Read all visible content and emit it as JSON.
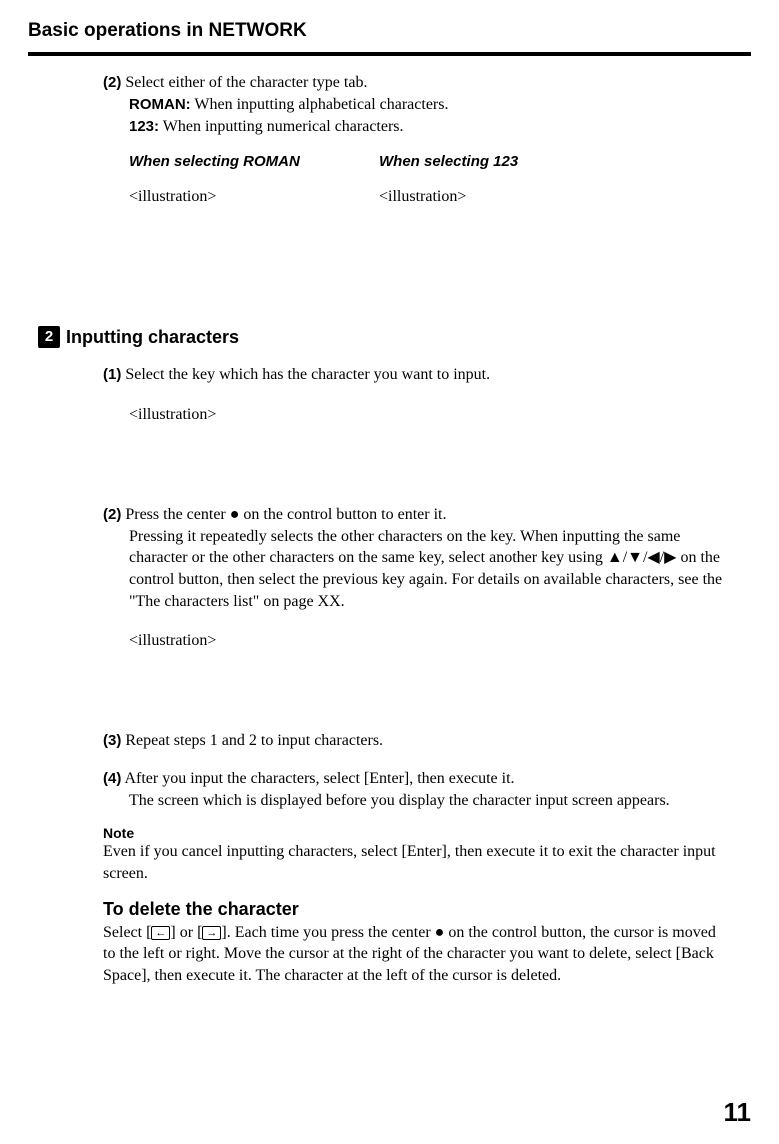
{
  "page_title": "Basic operations in NETWORK",
  "top": {
    "step2_num": "(2)",
    "step2_text": " Select either of the character type tab.",
    "roman_label": "ROMAN:",
    "roman_text": " When inputting alphabetical characters.",
    "n123_label": "123:",
    "n123_text": " When inputting numerical characters.",
    "col1_title": "When selecting ROMAN",
    "col2_title": "When selecting 123",
    "illus1": "<illustration>",
    "illus2": "<illustration>"
  },
  "section2": {
    "num": "2",
    "label": "Inputting characters"
  },
  "s2": {
    "step1_num": "(1)",
    "step1_text": " Select the key which has the character you want to input.",
    "illus1": "<illustration>",
    "step2_num": "(2)",
    "step2_line1": " Press the center ● on the control button to enter it.",
    "step2_body": "Pressing it repeatedly selects the other characters on the key. When inputting the same character or the other characters on the same key, select another key using ▲/▼/◀/▶ on the control button, then select the previous key again. For details on available characters, see the \"The characters list\" on page XX.",
    "illus2": "<illustration>",
    "step3_num": "(3)",
    "step3_text": " Repeat steps 1 and 2 to input characters.",
    "step4_num": "(4)",
    "step4_text": " After you input the characters, select [Enter], then execute it.",
    "step4_body": "The screen which is displayed before you display the character input screen appears."
  },
  "note": {
    "label": "Note",
    "text": "Even if you cancel inputting characters,  select [Enter], then execute it to exit the character input screen."
  },
  "delete": {
    "heading": "To delete the character",
    "pre": "Select [",
    "arrow1": "←",
    "mid": "] or [",
    "arrow2": "→",
    "post": "]. Each time you press the center ● on the control button, the cursor is moved to the left or right. Move the cursor at the right of the character you want to delete, select [Back Space], then execute it. The character at the left of the cursor is deleted."
  },
  "page_number": "11"
}
